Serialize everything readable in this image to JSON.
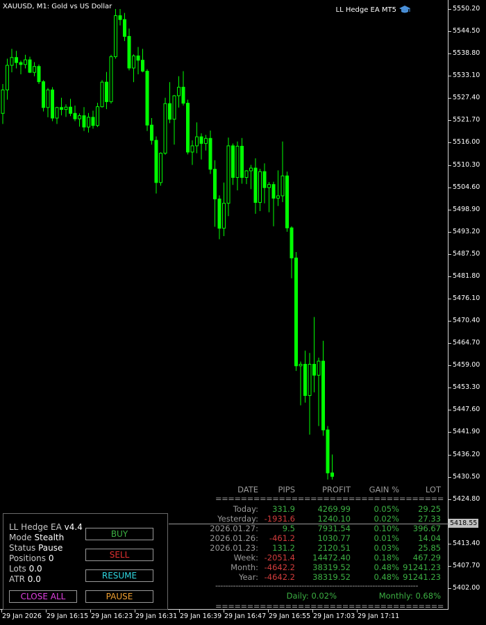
{
  "chart": {
    "symbol_title": "XAUUSD, M1:  Gold vs US Dollar",
    "ea_badge": "LL Hedge EA MT5",
    "current_price": "5418.55",
    "price_levels": [
      "5550.20",
      "5544.50",
      "5538.80",
      "5533.10",
      "5527.40",
      "5521.70",
      "5516.00",
      "5510.30",
      "5504.60",
      "5498.90",
      "5493.20",
      "5487.50",
      "5481.80",
      "5476.10",
      "5470.40",
      "5464.70",
      "5459.00",
      "5453.30",
      "5447.60",
      "5441.90",
      "5436.20",
      "5430.50",
      "5424.80",
      "5413.40",
      "5407.70",
      "5402.00"
    ],
    "time_labels": [
      "29 Jan 2026",
      "29 Jan 16:15",
      "29 Jan 16:23",
      "29 Jan 16:31",
      "29 Jan 16:39",
      "29 Jan 16:47",
      "29 Jan 16:55",
      "29 Jan 17:03",
      "29 Jan 17:11"
    ],
    "colors": {
      "bull": "#00ff00",
      "bear_fill": "#000000",
      "background": "#000000",
      "axis": "#d8d8d8"
    }
  },
  "panel": {
    "ea_name": "LL Hedge EA",
    "version": "v4.4",
    "mode_label": "Mode",
    "mode_value": "Stealth",
    "status_label": "Status",
    "status_value": "Pause",
    "positions_label": "Positions",
    "positions_value": "0",
    "lots_label": "Lots",
    "lots_value": "0.0",
    "atr_label": "ATR",
    "atr_value": "0.0",
    "buttons": {
      "buy": "BUY",
      "sell": "SELL",
      "resume": "RESUME",
      "close_all": "CLOSE ALL",
      "pause": "PAUSE"
    },
    "colors": {
      "buy": "#3cb043",
      "sell": "#e23030",
      "resume": "#2fd6e0",
      "close_all": "#e040e0",
      "pause": "#f0a030"
    }
  },
  "stats": {
    "headers": {
      "date": "DATE",
      "pips": "PIPS",
      "profit": "PROFIT",
      "gain": "GAIN %",
      "lot": "LOT"
    },
    "separator": "===============================================",
    "separator_dashed": "--------------------------------------------------------------------------------",
    "rows": [
      {
        "date": "Today:",
        "pips": "331.9",
        "profit": "4269.99",
        "gain": "0.05%",
        "lot": "29.25",
        "sign": "pos"
      },
      {
        "date": "Yesterday:",
        "pips": "-1931.6",
        "profit": "1240.10",
        "gain": "0.02%",
        "lot": "27.33",
        "sign": "neg"
      },
      {
        "date": "2026.01.27:",
        "pips": "9.5",
        "profit": "7931.54",
        "gain": "0.10%",
        "lot": "396.67",
        "sign": "pos"
      },
      {
        "date": "2026.01.26:",
        "pips": "-461.2",
        "profit": "1030.77",
        "gain": "0.01%",
        "lot": "14.04",
        "sign": "neg"
      },
      {
        "date": "2026.01.23:",
        "pips": "131.2",
        "profit": "2120.51",
        "gain": "0.03%",
        "lot": "25.85",
        "sign": "pos"
      },
      {
        "date": "Week:",
        "pips": "-2051.4",
        "profit": "14472.40",
        "gain": "0.18%",
        "lot": "467.29",
        "sign": "neg"
      },
      {
        "date": "Month:",
        "pips": "-4642.2",
        "profit": "38319.52",
        "gain": "0.48%",
        "lot": "91241.23",
        "sign": "neg"
      },
      {
        "date": "Year:",
        "pips": "-4642.2",
        "profit": "38319.52",
        "gain": "0.48%",
        "lot": "91241.23",
        "sign": "neg"
      }
    ],
    "daily": "Daily: 0.02%",
    "monthly": "Monthly: 0.68%"
  },
  "candles": [
    [
      5523.5,
      5531,
      5520.8,
      5529.5
    ],
    [
      5529.5,
      5537.5,
      5527,
      5535.8
    ],
    [
      5535.8,
      5540,
      5534,
      5537.8
    ],
    [
      5537.8,
      5539.5,
      5535,
      5536.5
    ],
    [
      5536.5,
      5537,
      5533.5,
      5536
    ],
    [
      5536,
      5538.5,
      5535,
      5537.2
    ],
    [
      5537.2,
      5538,
      5533.8,
      5534
    ],
    [
      5534,
      5536.6,
      5533,
      5535.5
    ],
    [
      5535.5,
      5536,
      5531,
      5531.6
    ],
    [
      5531.6,
      5532,
      5524,
      5525
    ],
    [
      5525,
      5530,
      5522.5,
      5529.5
    ],
    [
      5529.5,
      5530.2,
      5521.5,
      5522.3
    ],
    [
      5522.3,
      5525.2,
      5520.8,
      5525
    ],
    [
      5525,
      5527.5,
      5523,
      5524.5
    ],
    [
      5524.5,
      5525.8,
      5522.6,
      5525.1
    ],
    [
      5525.1,
      5527.2,
      5522.8,
      5523.5
    ],
    [
      5523.5,
      5525.5,
      5521.5,
      5522.1
    ],
    [
      5522.1,
      5523.5,
      5520.1,
      5522.9
    ],
    [
      5522.9,
      5525.1,
      5519,
      5520
    ],
    [
      5520,
      5523.6,
      5518.6,
      5522.5
    ],
    [
      5522.5,
      5524.2,
      5519.6,
      5520.4
    ],
    [
      5520.4,
      5526.2,
      5520,
      5525.2
    ],
    [
      5525.2,
      5532,
      5525,
      5531.5
    ],
    [
      5531.5,
      5534.1,
      5524.6,
      5526.5
    ],
    [
      5526.5,
      5538.5,
      5526,
      5538
    ],
    [
      5538,
      5550.2,
      5537.5,
      5548.5
    ],
    [
      5548.5,
      5550.2,
      5546,
      5547.5
    ],
    [
      5547.5,
      5549.2,
      5542,
      5543.2
    ],
    [
      5543.2,
      5545.2,
      5534.5,
      5535.1
    ],
    [
      5535.1,
      5538.6,
      5531.5,
      5538.2
    ],
    [
      5538.2,
      5540.5,
      5533.5,
      5537.1
    ],
    [
      5537.1,
      5540,
      5534,
      5534.3
    ],
    [
      5534.3,
      5534.8,
      5519,
      5520.5
    ],
    [
      5520.5,
      5522.3,
      5515.5,
      5516.6
    ],
    [
      5516.6,
      5517.6,
      5503,
      5505.8
    ],
    [
      5505.8,
      5513.5,
      5505,
      5513.3
    ],
    [
      5513.3,
      5527.5,
      5512.9,
      5526
    ],
    [
      5526,
      5531.5,
      5521,
      5522
    ],
    [
      5522,
      5528.2,
      5515.5,
      5528
    ],
    [
      5528,
      5533,
      5525,
      5530.2
    ],
    [
      5530.2,
      5534.3,
      5525.5,
      5526.1
    ],
    [
      5526.1,
      5527,
      5513,
      5513.6
    ],
    [
      5513.6,
      5516.6,
      5510.3,
      5515.2
    ],
    [
      5515.2,
      5521.2,
      5513.3,
      5517.5
    ],
    [
      5517.5,
      5518.4,
      5511.7,
      5515.8
    ],
    [
      5515.8,
      5518,
      5514,
      5517.1
    ],
    [
      5517.1,
      5519.1,
      5508,
      5509.2
    ],
    [
      5509.2,
      5511.5,
      5494.5,
      5501.6
    ],
    [
      5501.6,
      5502.5,
      5491.3,
      5494.1
    ],
    [
      5494.1,
      5505.8,
      5492.1,
      5500.5
    ],
    [
      5500.5,
      5517.3,
      5497.2,
      5515.2
    ],
    [
      5515.2,
      5515.8,
      5505.2,
      5507.1
    ],
    [
      5507.1,
      5516.3,
      5503.8,
      5515.1
    ],
    [
      5515.1,
      5517.2,
      5505.5,
      5507.1
    ],
    [
      5507.1,
      5509,
      5505.4,
      5508.8
    ],
    [
      5508.8,
      5510.3,
      5504.1,
      5509.5
    ],
    [
      5509.5,
      5512,
      5497.8,
      5500.7
    ],
    [
      5500.7,
      5509.3,
      5498.5,
      5508.6
    ],
    [
      5508.6,
      5510.7,
      5500.5,
      5504.5
    ],
    [
      5504.5,
      5505.9,
      5498.2,
      5505.3
    ],
    [
      5505.3,
      5506,
      5494.6,
      5501.8
    ],
    [
      5501.8,
      5508.9,
      5499.8,
      5502.4
    ],
    [
      5502.4,
      5516.3,
      5500.8,
      5507.5
    ],
    [
      5507.5,
      5508.6,
      5493.2,
      5494.2
    ],
    [
      5494.2,
      5494.6,
      5481.3,
      5486.5
    ],
    [
      5486.5,
      5488,
      5457.6,
      5458.9
    ],
    [
      5458.9,
      5460,
      5448.8,
      5459.3
    ],
    [
      5459.3,
      5462.8,
      5449.5,
      5451.3
    ],
    [
      5451.3,
      5462.2,
      5441.3,
      5459.3
    ],
    [
      5459.3,
      5471.4,
      5452.1,
      5456.5
    ],
    [
      5456.5,
      5461,
      5443.5,
      5460.1
    ],
    [
      5460.1,
      5465.3,
      5441,
      5442.5
    ],
    [
      5442.5,
      5443.5,
      5429.8,
      5431.5
    ],
    [
      5431.5,
      5436.2,
      5429.8,
      5430.6
    ]
  ]
}
